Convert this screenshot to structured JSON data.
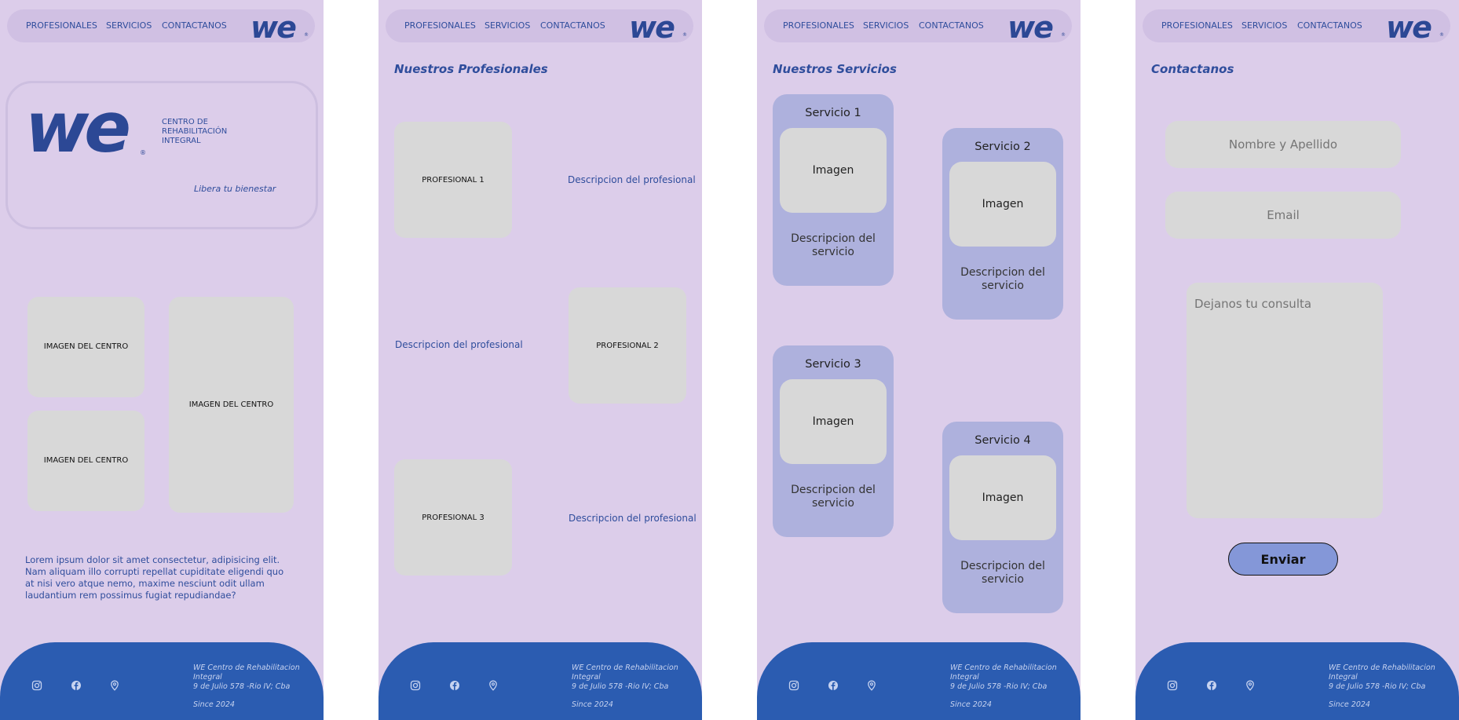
{
  "nav": {
    "professionals": "PROFESIONALES",
    "services": "SERVICIOS",
    "contact": "CONTACTANOS",
    "logo": "we",
    "reg": "®"
  },
  "home": {
    "logo": "we",
    "tagline": "CENTRO DE REHABILITACIÓN INTEGRAL",
    "slogan": "Libera tu bienestar",
    "image_label": "IMAGEN DEL CENTRO",
    "lorem": "Lorem ipsum dolor sit amet consectetur, adipisicing elit. Nam aliquam illo corrupti repellat cupiditate eligendi quo at nisi vero atque nemo, maxime nesciunt odit ullam laudantium rem possimus fugiat repudiandae?"
  },
  "professionals": {
    "title": "Nuestros Profesionales",
    "items": [
      {
        "name": "PROFESIONAL 1",
        "desc": "Descripcion del profesional"
      },
      {
        "name": "PROFESIONAL 2",
        "desc": "Descripcion del profesional"
      },
      {
        "name": "PROFESIONAL 3",
        "desc": "Descripcion del profesional"
      }
    ]
  },
  "services": {
    "title": "Nuestros Servicios",
    "image_label": "Imagen",
    "items": [
      {
        "name": "Servicio 1",
        "desc": "Descripcion del servicio"
      },
      {
        "name": "Servicio 2",
        "desc": "Descripcion del servicio"
      },
      {
        "name": "Servicio 3",
        "desc": "Descripcion del servicio"
      },
      {
        "name": "Servicio 4",
        "desc": "Descripcion del servicio"
      }
    ]
  },
  "contact": {
    "title": "Contactanos",
    "name_placeholder": "Nombre y Apellido",
    "email_placeholder": "Email",
    "message_placeholder": "Dejanos tu consulta",
    "send": "Enviar"
  },
  "footer": {
    "company": "WE Centro de Rehabilitacion Integral",
    "address": "9 de Julio 578 -Rio IV; Cba",
    "since": "Since 2024",
    "icons": [
      "instagram-icon",
      "facebook-icon",
      "location-pin-icon"
    ]
  },
  "colors": {
    "bg": "#dccdea",
    "nav": "#d0c0e3",
    "brand": "#2c4895",
    "footer": "#2b5cb1",
    "card": "#aeb1dd",
    "placeholder": "#d8d8d8",
    "button": "#8497d8"
  }
}
